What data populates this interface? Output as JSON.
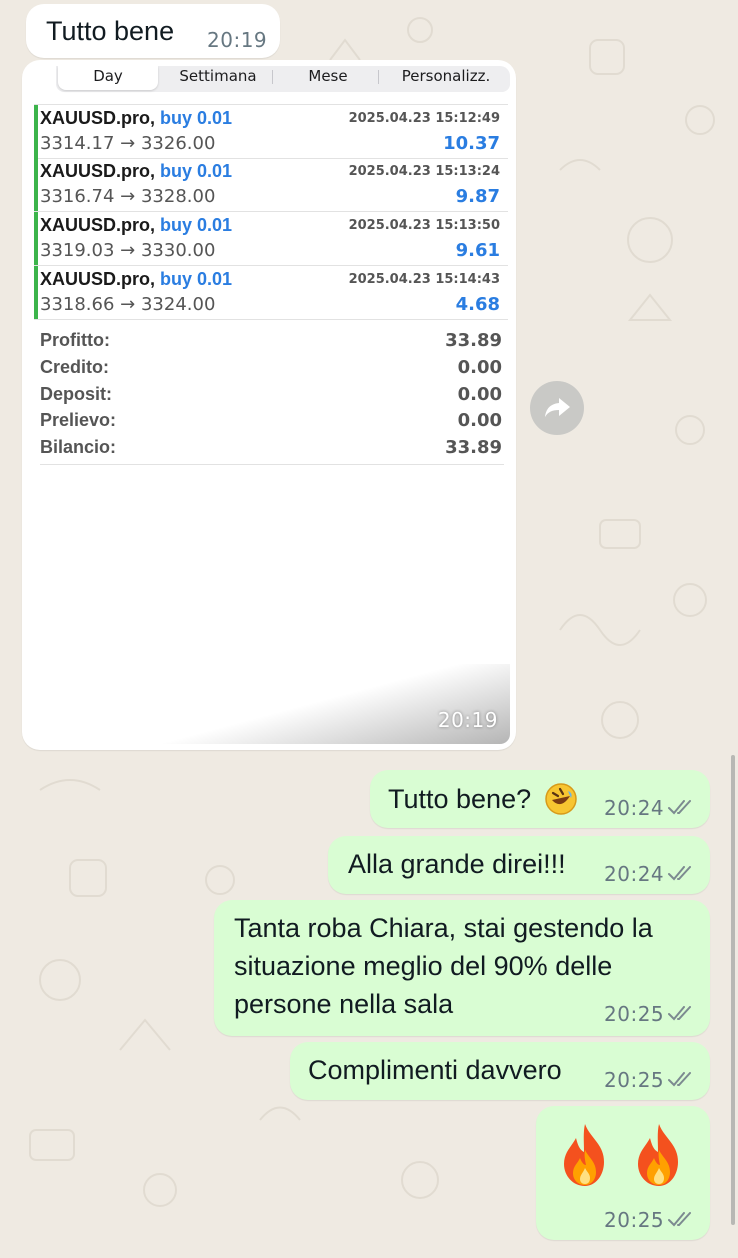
{
  "messages_in": {
    "first": {
      "text": "Tutto bene",
      "time": "20:19"
    },
    "screenshot_time": "20:19"
  },
  "trading": {
    "tabs": [
      "Day",
      "Settimana",
      "Mese",
      "Personalizz."
    ],
    "active_tab": "Day",
    "trades": [
      {
        "symbol": "XAUUSD.pro,",
        "side": "buy 0.01",
        "prices": "3314.17 → 3326.00",
        "datetime": "2025.04.23 15:12:49",
        "profit": "10.37"
      },
      {
        "symbol": "XAUUSD.pro,",
        "side": "buy 0.01",
        "prices": "3316.74 → 3328.00",
        "datetime": "2025.04.23 15:13:24",
        "profit": "9.87"
      },
      {
        "symbol": "XAUUSD.pro,",
        "side": "buy 0.01",
        "prices": "3319.03 → 3330.00",
        "datetime": "2025.04.23 15:13:50",
        "profit": "9.61"
      },
      {
        "symbol": "XAUUSD.pro,",
        "side": "buy 0.01",
        "prices": "3318.66 → 3324.00",
        "datetime": "2025.04.23 15:14:43",
        "profit": "4.68"
      }
    ],
    "summary": [
      {
        "label": "Profitto:",
        "value": "33.89"
      },
      {
        "label": "Credito:",
        "value": "0.00"
      },
      {
        "label": "Deposit:",
        "value": "0.00"
      },
      {
        "label": "Prelievo:",
        "value": "0.00"
      },
      {
        "label": "Bilancio:",
        "value": "33.89"
      }
    ]
  },
  "messages_out": [
    {
      "text": "Tutto bene?",
      "emoji": "rolling-on-floor-laughing",
      "time": "20:24"
    },
    {
      "text": "Alla grande direi!!!",
      "time": "20:24"
    },
    {
      "lines": [
        "Tanta roba Chiara, stai gestendo la",
        "situazione meglio del 90% delle",
        "persone nella sala"
      ],
      "time": "20:25"
    },
    {
      "text": "Complimenti davvero",
      "time": "20:25"
    },
    {
      "emoji": "fire fire",
      "time": "20:25"
    }
  ],
  "colors": {
    "incoming": "#ffffff",
    "outgoing": "#d9fdd3",
    "background": "#efeae2",
    "link_blue": "#2a7de1",
    "trade_bar": "#3cb44b"
  },
  "icons": [
    "forward-icon",
    "double-check-icon"
  ]
}
